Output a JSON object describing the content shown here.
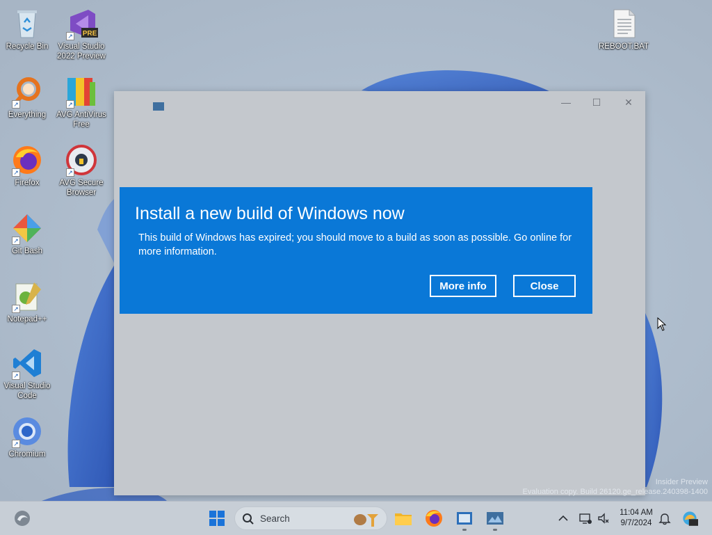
{
  "desktop": {
    "icons": [
      {
        "label": "Recycle Bin"
      },
      {
        "label": "Visual Studio 2022 Preview",
        "badge": "PRE"
      },
      {
        "label": "Everything"
      },
      {
        "label": "AVG AntiVirus Free"
      },
      {
        "label": "Firefox"
      },
      {
        "label": "AVG Secure Browser"
      },
      {
        "label": "Git Bash"
      },
      {
        "label": "Notepad++"
      },
      {
        "label": "Visual Studio Code"
      },
      {
        "label": "Chromium"
      },
      {
        "label": "REBOOT.BAT"
      }
    ]
  },
  "window": {
    "controls": {
      "minimize": "—",
      "maximize": "☐",
      "close": "✕"
    }
  },
  "dialog": {
    "title": "Install a new build of Windows now",
    "message": "This build of Windows has expired; you should move to a build as soon as possible. Go online for more information.",
    "more_info_label": "More info",
    "close_label": "Close",
    "background_color": "#0a78d7"
  },
  "watermark": {
    "line1": "Insider Preview",
    "line2": "Evaluation copy. Build 26120.ge_release.240398-1400"
  },
  "taskbar": {
    "search_label": "Search",
    "clock_time": "11:04 AM",
    "clock_date": "9/7/2024",
    "icons": [
      "widgets-icon",
      "start-icon",
      "search-icon",
      "file-explorer-icon",
      "firefox-icon",
      "app-window-icon",
      "app-blue-icon"
    ]
  },
  "tray": {
    "icons": [
      "chevron-up-icon",
      "network-icon",
      "volume-icon",
      "notification-bell-icon",
      "copilot-icon"
    ]
  }
}
